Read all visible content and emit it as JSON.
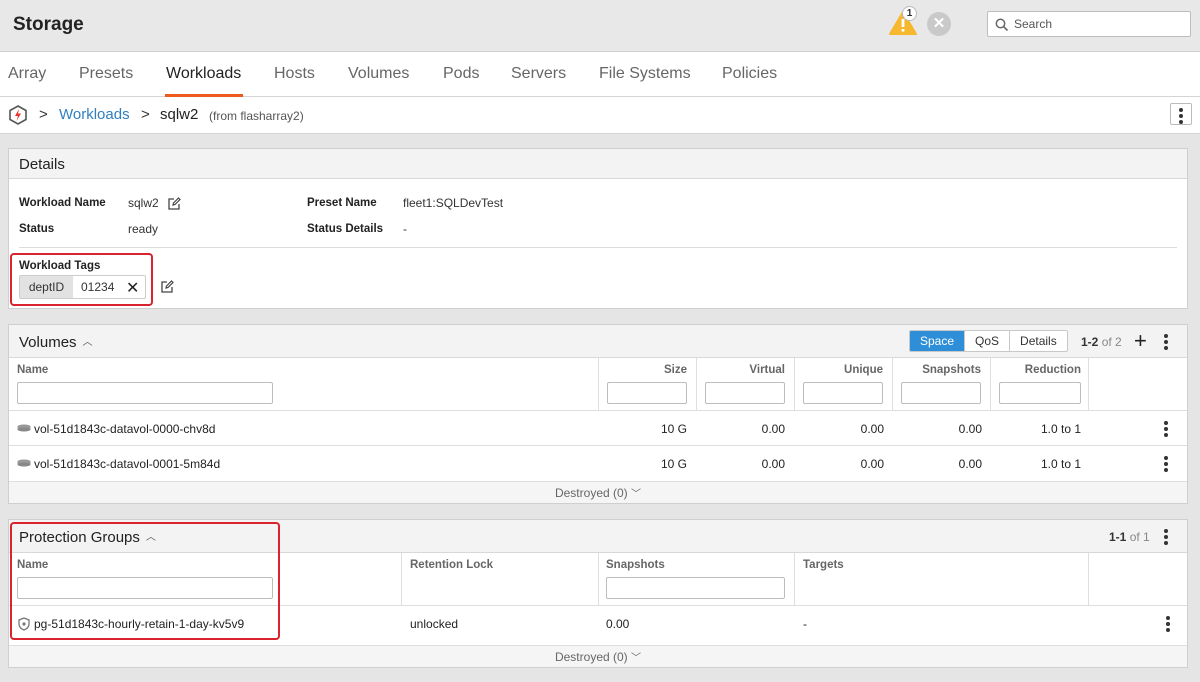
{
  "app": {
    "title": "Storage",
    "alert_count": "1",
    "search_placeholder": "Search"
  },
  "tabs": [
    "Array",
    "Presets",
    "Workloads",
    "Hosts",
    "Volumes",
    "Pods",
    "Servers",
    "File Systems",
    "Policies"
  ],
  "active_tab": "Workloads",
  "breadcrumb": {
    "sep": ">",
    "parent": "Workloads",
    "current": "sqlw2",
    "source": "(from flasharray2)"
  },
  "details": {
    "title": "Details",
    "workload_name_label": "Workload Name",
    "workload_name": "sqlw2",
    "status_label": "Status",
    "status": "ready",
    "preset_name_label": "Preset Name",
    "preset_name": "fleet1:SQLDevTest",
    "status_details_label": "Status Details",
    "status_details": "-",
    "tags_label": "Workload Tags",
    "tag_key": "deptID",
    "tag_value": "01234"
  },
  "volumes": {
    "title": "Volumes",
    "views": [
      "Space",
      "QoS",
      "Details"
    ],
    "active_view": "Space",
    "pager_range": "1-2",
    "pager_total": "of 2",
    "columns": [
      "Name",
      "Size",
      "Virtual",
      "Unique",
      "Snapshots",
      "Reduction"
    ],
    "rows": [
      {
        "name": "vol-51d1843c-datavol-0000-chv8d",
        "size": "10 G",
        "virtual": "0.00",
        "unique": "0.00",
        "snapshots": "0.00",
        "reduction": "1.0 to 1"
      },
      {
        "name": "vol-51d1843c-datavol-0001-5m84d",
        "size": "10 G",
        "virtual": "0.00",
        "unique": "0.00",
        "snapshots": "0.00",
        "reduction": "1.0 to 1"
      }
    ],
    "footer": "Destroyed (0)"
  },
  "protection_groups": {
    "title": "Protection Groups",
    "pager_range": "1-1",
    "pager_total": "of 1",
    "columns": [
      "Name",
      "Retention Lock",
      "Snapshots",
      "Targets"
    ],
    "rows": [
      {
        "name": "pg-51d1843c-hourly-retain-1-day-kv5v9",
        "retention_lock": "unlocked",
        "snapshots": "0.00",
        "targets": "-"
      }
    ],
    "footer": "Destroyed (0)"
  },
  "colors": {
    "accent": "#f0591e",
    "link": "#2f7fc1",
    "highlight": "#d9232f",
    "view_active": "#2e8fd8"
  }
}
